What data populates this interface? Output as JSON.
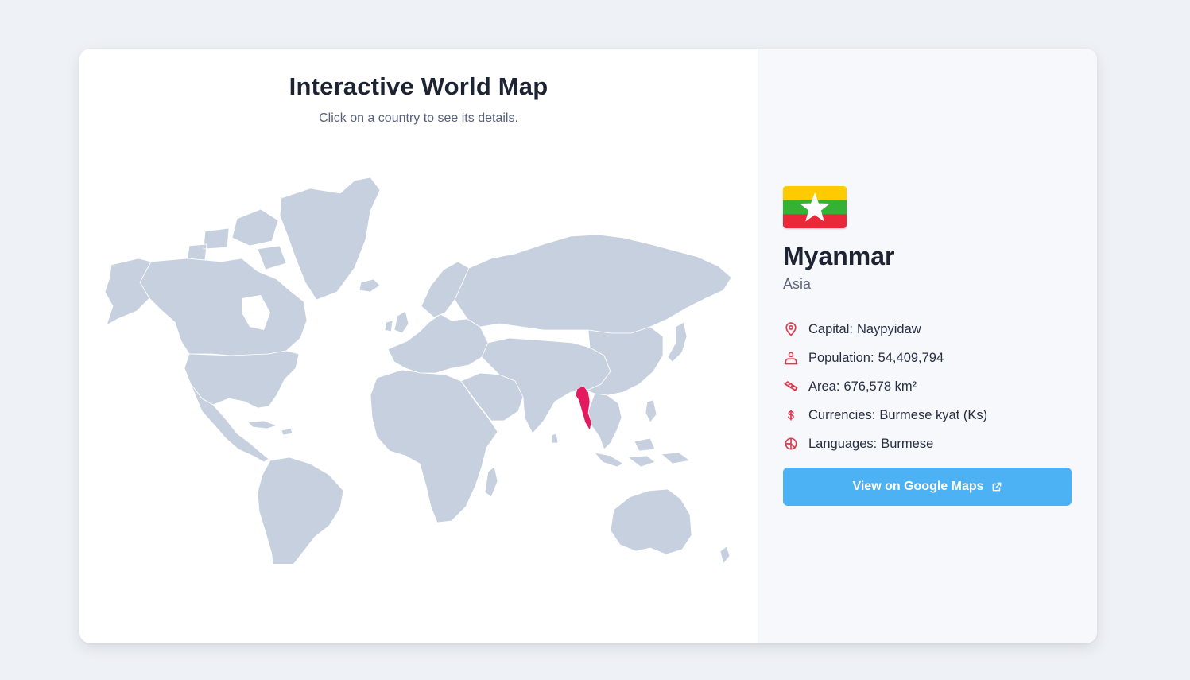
{
  "map": {
    "title": "Interactive World Map",
    "subtitle": "Click on a country to see its details.",
    "land_color": "#c6d0de",
    "selected_color": "#e5195e"
  },
  "country": {
    "name": "Myanmar",
    "continent": "Asia",
    "flag_icon": "myanmar-flag",
    "flag_colors": [
      "#FECB00",
      "#34B233",
      "#EA2839",
      "#FFFFFF"
    ]
  },
  "facts": [
    {
      "icon": "map-pin-icon",
      "label": "Capital:",
      "value": "Naypyidaw"
    },
    {
      "icon": "people-icon",
      "label": "Population:",
      "value": "54,409,794"
    },
    {
      "icon": "ruler-icon",
      "label": "Area:",
      "value": "676,578 km²"
    },
    {
      "icon": "dollar-icon",
      "label": "Currencies:",
      "value": "Burmese kyat (Ks)"
    },
    {
      "icon": "language-icon",
      "label": "Languages:",
      "value": "Burmese"
    }
  ],
  "button": {
    "label": "View on Google Maps",
    "icon": "external-link-icon",
    "color": "#4db2f4"
  },
  "colors": {
    "page_bg": "#eef1f5",
    "accent": "#e03a4e"
  }
}
